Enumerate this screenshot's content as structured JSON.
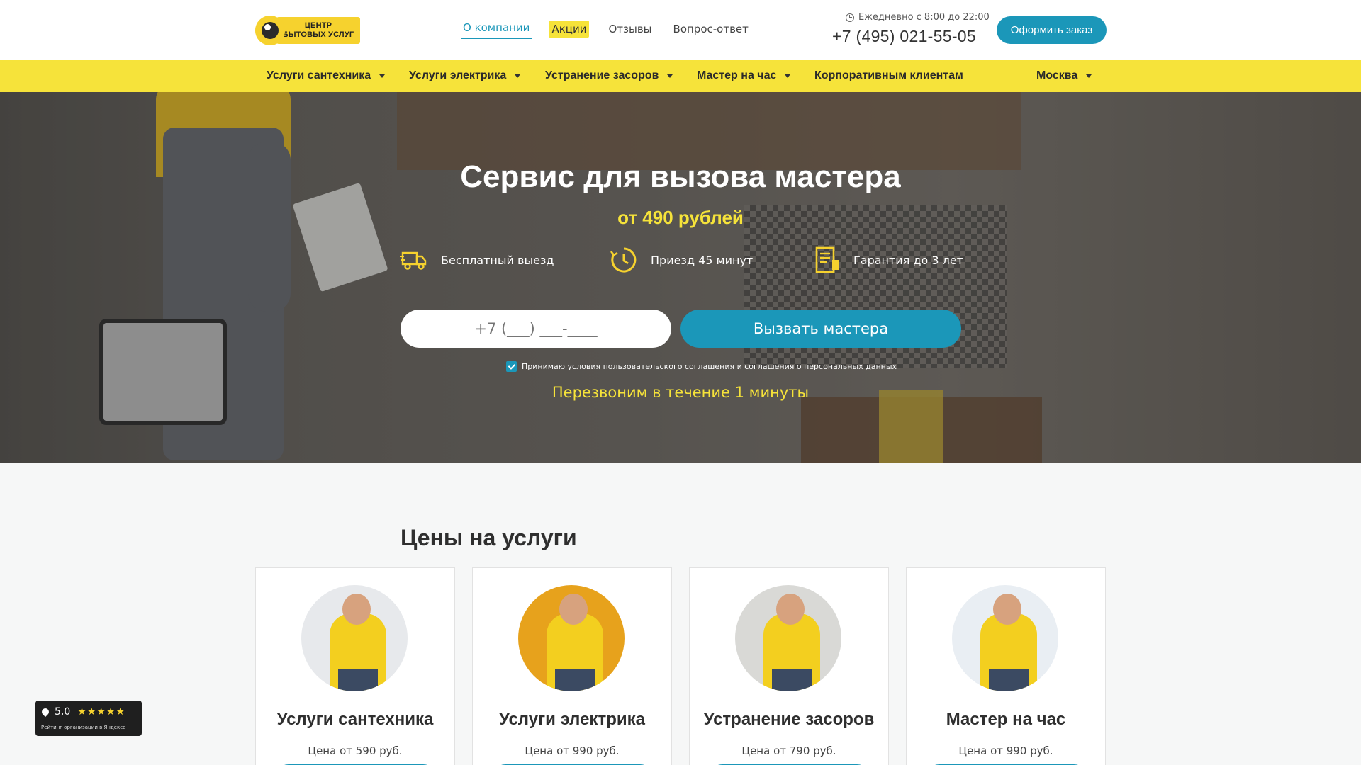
{
  "header": {
    "logo": {
      "line1": "ЦЕНТР",
      "line2": "БЫТОВЫХ УСЛУГ"
    },
    "topnav": [
      "О компании",
      "Акции",
      "Отзывы",
      "Вопрос-ответ"
    ],
    "hours": "Ежедневно с 8:00 до 22:00",
    "phone": "+7 (495) 021-55-05",
    "order_label": "Оформить заказ"
  },
  "mainnav": {
    "items": [
      "Услуги сантехника",
      "Услуги электрика",
      "Устранение засоров",
      "Мастер на час",
      "Корпоративным клиентам"
    ],
    "city": "Москва"
  },
  "hero": {
    "title": "Сервис для вызова мастера",
    "subtitle": "от 490 рублей",
    "features": [
      {
        "icon": "truck-icon",
        "label": "Бесплатный выезд"
      },
      {
        "icon": "clock-icon",
        "label": "Приезд 45 минут"
      },
      {
        "icon": "document-icon",
        "label": "Гарантия до 3 лет"
      }
    ],
    "phone_placeholder": "+7 (___) ___-____",
    "call_label": "Вызвать мастера",
    "agree_prefix": "Принимаю условия",
    "agree_link1": "пользовательского соглашения",
    "agree_and": "и",
    "agree_link2": "соглашения о персональных данных",
    "callback": "Перезвоним в течение 1 минуты"
  },
  "prices": {
    "title": "Цены на услуги",
    "cards": [
      {
        "name": "Услуги сантехника",
        "price": "Цена от 590 руб."
      },
      {
        "name": "Услуги электрика",
        "price": "Цена от 990 руб."
      },
      {
        "name": "Устранение засоров",
        "price": "Цена от 790 руб."
      },
      {
        "name": "Мастер на час",
        "price": "Цена от 990 руб."
      }
    ]
  },
  "yandex": {
    "rating": "5,0",
    "stars": "★★★★★",
    "caption": "Рейтинг организации в Яндексе"
  },
  "colors": {
    "accent": "#1b97b9",
    "yellow": "#f6e33a"
  }
}
